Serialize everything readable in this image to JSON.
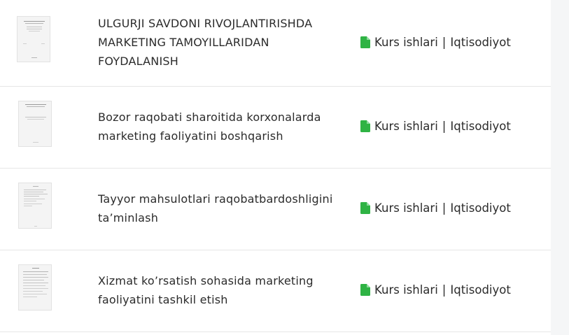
{
  "items": [
    {
      "title": "ULGURJI SAVDONI RIVOJLANTIRISHDA MARKETING TAMOYILLARIDAN FOYDALANISH",
      "category": "Kurs ishlari",
      "separator": "|",
      "subcategory": "Iqtisodiyot",
      "icon": "file-icon",
      "icon_color": "#2fb344"
    },
    {
      "title": "Bozor raqobati sharoitida korxonalarda marketing faoliyatini boshqarish",
      "category": "Kurs ishlari",
      "separator": "|",
      "subcategory": "Iqtisodiyot",
      "icon": "file-icon",
      "icon_color": "#2fb344"
    },
    {
      "title": "Tayyor mahsulotlari raqobatbardoshligini ta’minlash",
      "category": "Kurs ishlari",
      "separator": "|",
      "subcategory": "Iqtisodiyot",
      "icon": "file-icon",
      "icon_color": "#2fb344"
    },
    {
      "title": "Xizmat ko’rsatish sohasida marketing faoliyatini tashkil etish",
      "category": "Kurs ishlari",
      "separator": "|",
      "subcategory": "Iqtisodiyot",
      "icon": "file-icon",
      "icon_color": "#2fb344"
    }
  ]
}
